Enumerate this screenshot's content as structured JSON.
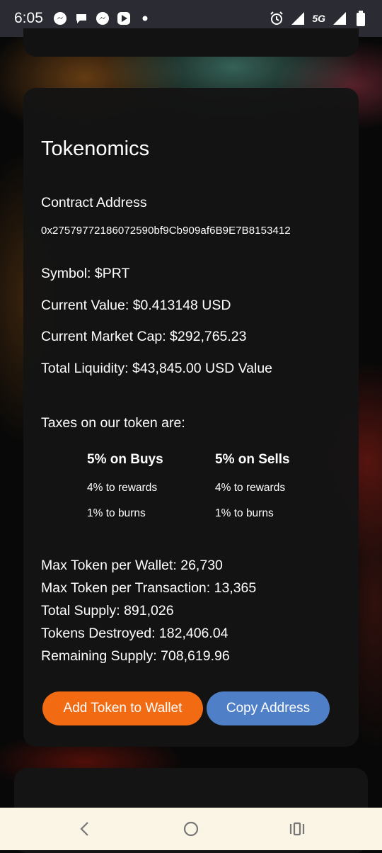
{
  "status_bar": {
    "time": "6:05",
    "network": "5G",
    "icons": [
      "messenger-icon",
      "chat-bubble-icon",
      "messenger-icon",
      "play-icon",
      "dot-icon",
      "alarm-icon",
      "signal-icon",
      "signal-icon",
      "battery-icon"
    ]
  },
  "tokenomics": {
    "title": "Tokenomics",
    "contract_label": "Contract Address",
    "contract_address": "0x27579772186072590bf9Cb909af6B9E7B8153412",
    "symbol": "Symbol: $PRT",
    "current_value": "Current Value: $0.413148 USD",
    "market_cap": "Current Market Cap: $292,765.23",
    "liquidity": "Total Liquidity: $43,845.00 USD Value",
    "taxes_heading": "Taxes on our token are:",
    "buys": {
      "title": "5% on Buys",
      "rewards": "4% to rewards",
      "burns": "1% to burns"
    },
    "sells": {
      "title": "5% on Sells",
      "rewards": "4% to rewards",
      "burns": "1% to burns"
    },
    "max_wallet": "Max Token per Wallet: 26,730",
    "max_tx": "Max Token per Transaction: 13,365",
    "total_supply": "Total Supply: 891,026",
    "destroyed": "Tokens Destroyed: 182,406.04",
    "remaining": "Remaining Supply: 708,619.96",
    "add_button": "Add Token to Wallet",
    "copy_button": "Copy Address"
  },
  "colors": {
    "add_button": "#f26a12",
    "copy_button": "#4f7fc6",
    "card": "#141414",
    "nav_bar": "#fbf5e6"
  }
}
